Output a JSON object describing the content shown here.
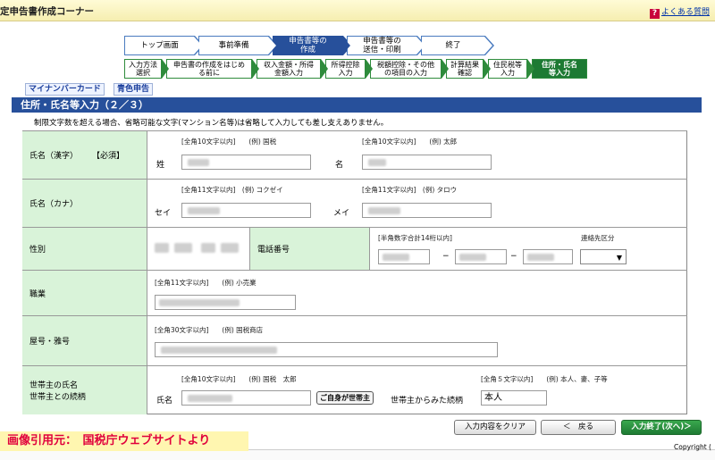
{
  "header": {
    "title": "定申告書作成コーナー",
    "faq_icon": "?",
    "faq_label": "よくある質問"
  },
  "steps_main": [
    {
      "label": "トップ画面"
    },
    {
      "label": "事前準備"
    },
    {
      "label": "申告書等の\n作成",
      "active": true
    },
    {
      "label": "申告書等の\n送信・印刷"
    },
    {
      "label": "終了"
    }
  ],
  "steps_sub": [
    {
      "label": "入力方法\n選択"
    },
    {
      "label": "申告書の作成をはじめ\nる前に"
    },
    {
      "label": "収入金額・所得\n金額入力"
    },
    {
      "label": "所得控除\n入力"
    },
    {
      "label": "税額控除・その他\nの項目の入力"
    },
    {
      "label": "計算結果\n確認"
    },
    {
      "label": "住民税等\n入力"
    },
    {
      "label": "住所・氏名\n等入力",
      "active": true
    }
  ],
  "tabs": {
    "mynumber": "マイナンバーカード",
    "blue": "青色申告"
  },
  "section_title": "住所・氏名等入力（２／３）",
  "note": "制限文字数を超える場合、省略可能な文字(マンション名等)は省略して入力しても差し支えありません。",
  "form": {
    "name_kanji": {
      "label": "氏名（漢字）",
      "required": "【必須】",
      "sei_hint": "[全角10文字以内]　　(例) 国税",
      "mei_hint": "[全角10文字以内]　　(例) 太郎",
      "sei_label": "姓",
      "mei_label": "名"
    },
    "name_kana": {
      "label": "氏名（カナ）",
      "sei_hint": "[全角11文字以内]　(例) コクゼイ",
      "mei_hint": "[全角11文字以内]　(例) タロウ",
      "sei_label": "セイ",
      "mei_label": "メイ"
    },
    "gender": {
      "label": "性別"
    },
    "phone": {
      "label": "電話番号",
      "hint": "[半角数字合計14桁以内]",
      "type_label": "連絡先区分",
      "dash": "−"
    },
    "occupation": {
      "label": "職業",
      "hint": "[全角11文字以内]　　(例) 小売業"
    },
    "shop_name": {
      "label": "屋号・雅号",
      "hint": "[全角30文字以内]　　(例) 国税商店"
    },
    "householder": {
      "label_line1": "世帯主の氏名",
      "label_line2": "世帯主との続柄",
      "name_hint": "[全角10文字以内]　　(例) 国税　太郎",
      "rel_hint": "[全角５文字以内]　　(例) 本人、妻、子等",
      "name_label": "氏名",
      "self_button": "ご自身が世帯主",
      "rel_label": "世帯主からみた続柄",
      "rel_value": "本人"
    }
  },
  "buttons": {
    "clear": "入力内容をクリア",
    "back": "＜　戻る",
    "next": "入力終了(次へ)＞"
  },
  "source": "画像引用元：　国税庁ウェブサイトより",
  "copyright": "Copyright ("
}
